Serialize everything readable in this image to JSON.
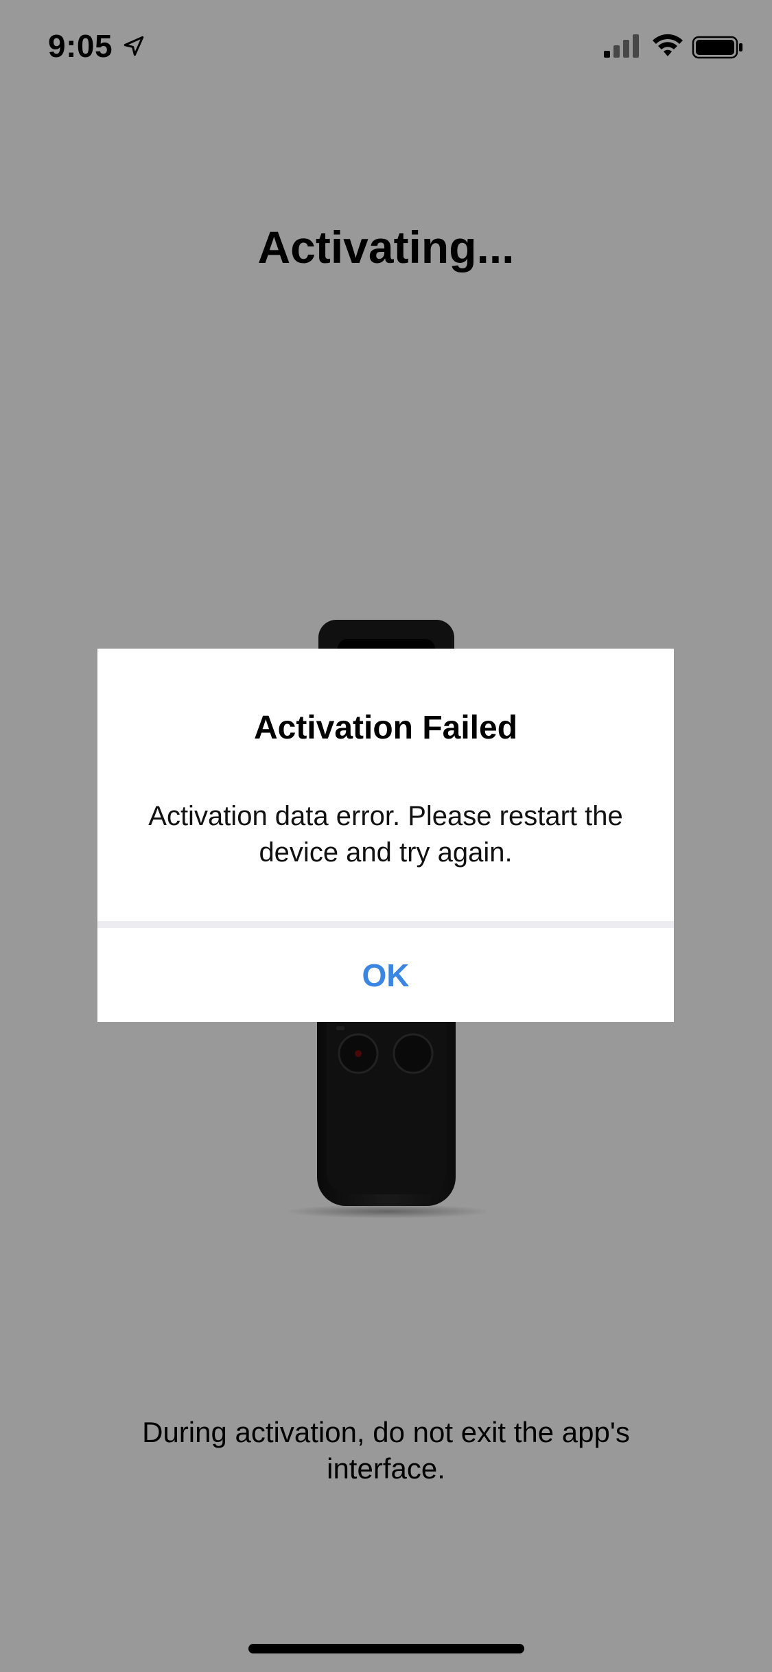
{
  "status_bar": {
    "time": "9:05",
    "icons": [
      "location-arrow-icon",
      "cellular-signal-icon",
      "wifi-icon",
      "battery-icon"
    ]
  },
  "page": {
    "title": "Activating...",
    "hint": "During activation, do not exit the app's interface."
  },
  "dialog": {
    "title": "Activation Failed",
    "message": "Activation data error. Please restart the device and try again.",
    "ok_label": "OK"
  },
  "colors": {
    "accent": "#3b86e3",
    "dialog_background": "#ffffff",
    "overlay": "rgba(0,0,0,0.40)"
  }
}
